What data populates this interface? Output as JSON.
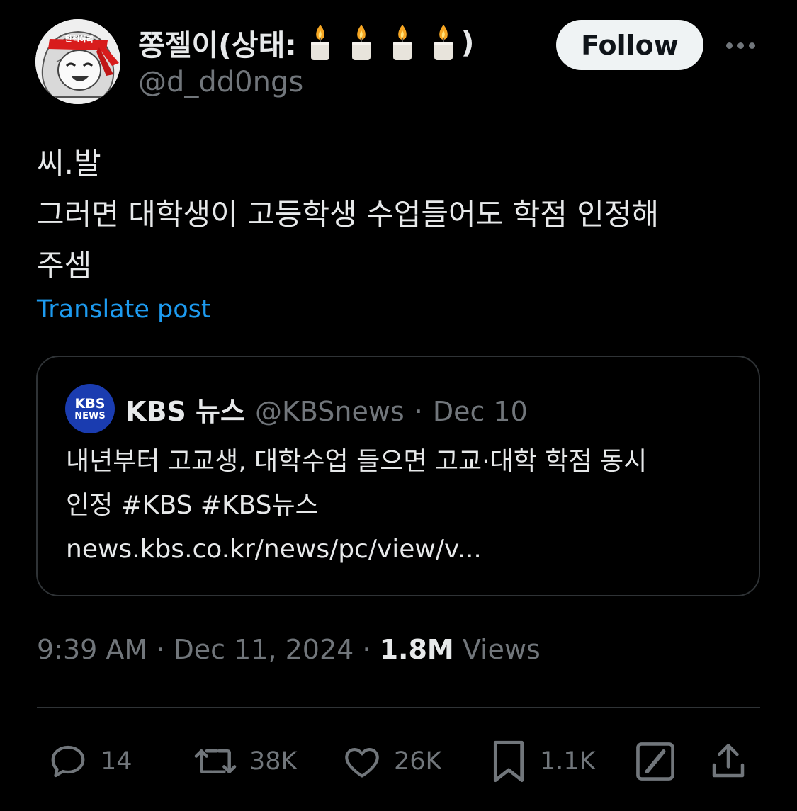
{
  "author": {
    "display_name": "쫑젤이(상태:",
    "display_name_suffix": ")",
    "status_emojis": [
      "candle",
      "candle",
      "candle",
      "candle"
    ],
    "handle": "@d_dd0ngs",
    "avatar_headband_text": "탄핵하라"
  },
  "follow_button": {
    "label": "Follow"
  },
  "more_button": {
    "icon": "more-horizontal-icon"
  },
  "tweet": {
    "lines": [
      "씨.발",
      "그러면 대학생이 고등학생 수업들어도 학점 인정해",
      "주셈"
    ],
    "translate_label": "Translate post"
  },
  "quote": {
    "logo_top": "KBS",
    "logo_bottom": "NEWS",
    "name": "KBS 뉴스",
    "handle": "@KBSnews",
    "separator": "·",
    "date": "Dec 10",
    "lines": [
      "내년부터 고교생, 대학수업 들으면 고교·대학 학점 동시",
      "인정 #KBS #KBS뉴스",
      "news.kbs.co.kr/news/pc/view/v..."
    ]
  },
  "meta": {
    "time": "9:39 AM",
    "sep1": "·",
    "date": "Dec 11, 2024",
    "sep2": "·",
    "views_count": "1.8M",
    "views_label": "Views"
  },
  "actions": {
    "replies": "14",
    "reposts": "38K",
    "likes": "26K",
    "bookmarks": "1.1K"
  },
  "colors": {
    "background": "#000000",
    "text": "#e7e9ea",
    "muted": "#71767b",
    "link": "#1d9bf0",
    "border": "#2f3336",
    "follow_bg": "#eff3f4",
    "kbs_blue": "#1a3cb0"
  }
}
